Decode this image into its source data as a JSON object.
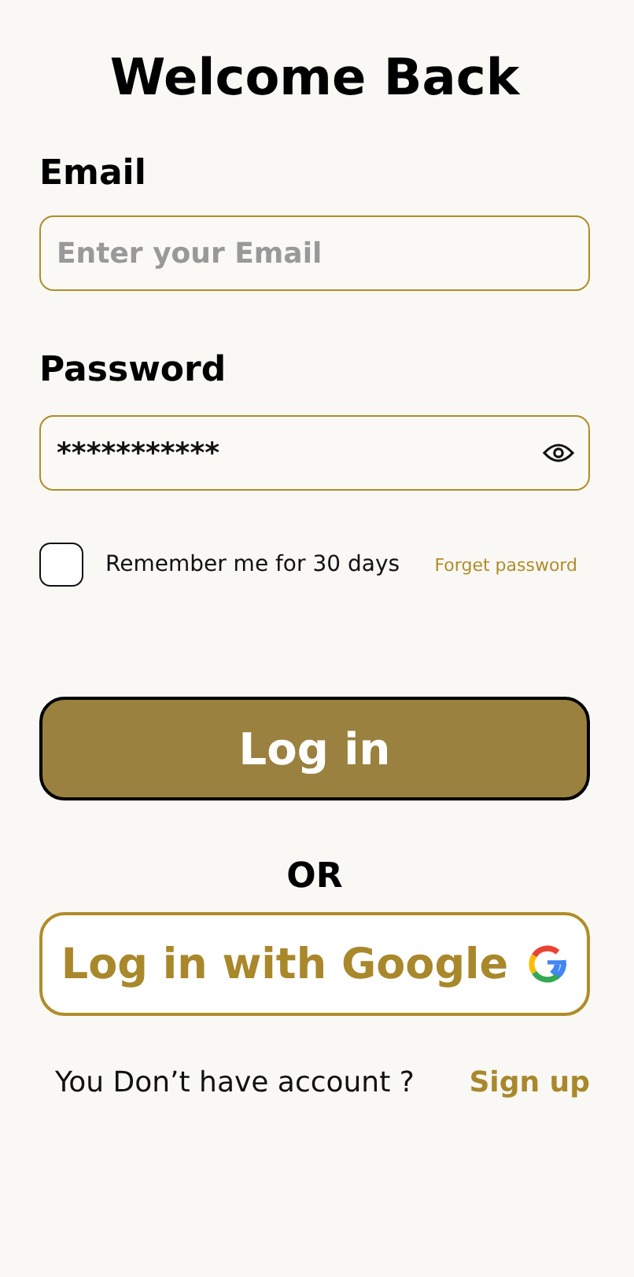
{
  "title": "Welcome Back",
  "email": {
    "label": "Email",
    "placeholder": "Enter your Email"
  },
  "password": {
    "label": "Password",
    "value": "***********"
  },
  "remember": {
    "label": "Remember me for 30 days",
    "checked": false
  },
  "forgot_link": "Forget password",
  "login_button": "Log in",
  "divider": "OR",
  "google_button": "Log in with Google",
  "signup": {
    "prompt": "You Don’t have account ?",
    "link": "Sign up"
  }
}
